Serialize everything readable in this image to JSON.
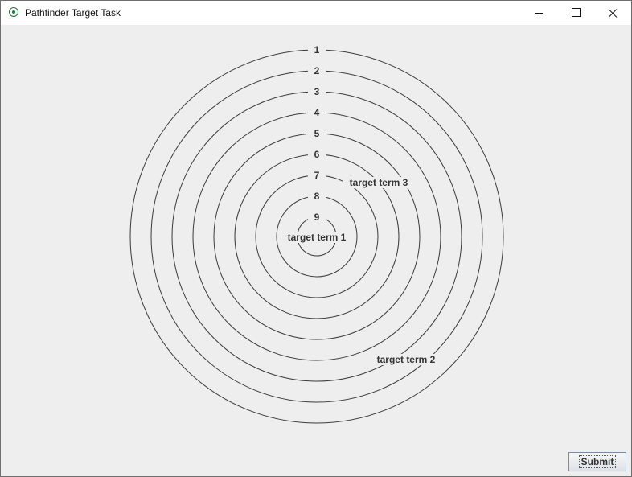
{
  "window": {
    "title": "Pathfinder Target Task",
    "icon": "target-icon"
  },
  "target": {
    "rings": [
      {
        "label": "1"
      },
      {
        "label": "2"
      },
      {
        "label": "3"
      },
      {
        "label": "4"
      },
      {
        "label": "5"
      },
      {
        "label": "6"
      },
      {
        "label": "7"
      },
      {
        "label": "8"
      },
      {
        "label": "9"
      }
    ],
    "terms": [
      {
        "text": "target term 1",
        "ring": "9"
      },
      {
        "text": "target term 3",
        "ring": "7"
      },
      {
        "text": "target term 2",
        "ring": "1"
      }
    ]
  },
  "actions": {
    "submit_label": "Submit"
  }
}
